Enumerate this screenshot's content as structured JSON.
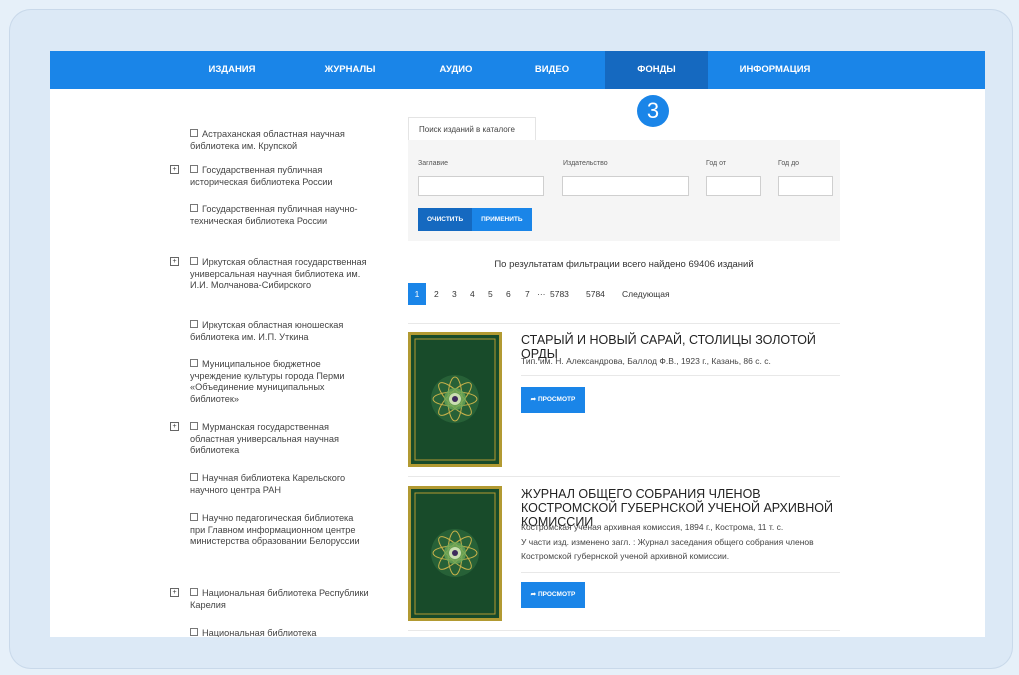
{
  "nav": {
    "items": [
      {
        "label": "ИЗДАНИЯ"
      },
      {
        "label": "ЖУРНАЛЫ"
      },
      {
        "label": "АУДИО"
      },
      {
        "label": "ВИДЕО"
      },
      {
        "label": "ФОНДЫ"
      },
      {
        "label": "ИНФОРМАЦИЯ"
      }
    ],
    "active_index": 4
  },
  "step_badge": "3",
  "sidebar": {
    "libraries": [
      {
        "label": "Астраханская областная научная библиотека им. Крупской",
        "expandable": false
      },
      {
        "label": "Государственная публичная историческая библиотека России",
        "expandable": true
      },
      {
        "label": "Государственная публичная научно-техническая библиотека России",
        "expandable": false
      },
      {
        "label": "Иркутская областная государственная универсальная научная библиотека им. И.И. Молчанова-Сибирского",
        "expandable": true
      },
      {
        "label": "Иркутская областная юношеская библиотека им. И.П. Уткина",
        "expandable": false
      },
      {
        "label": "Муниципальное бюджетное учреждение культуры города Перми «Объединение муниципальных библиотек»",
        "expandable": false
      },
      {
        "label": "Мурманская государственная областная универсальная научная библиотека",
        "expandable": true
      },
      {
        "label": "Научная библиотека Карельского научного центра РАН",
        "expandable": false
      },
      {
        "label": "Научно педагогическая библиотека при Главном информационном центре министерства образовании Белоруссии",
        "expandable": false
      },
      {
        "label": "Национальная библиотека Республики Карелия",
        "expandable": true
      },
      {
        "label": "Национальная библиотека",
        "expandable": false
      }
    ],
    "expand_symbol": "+"
  },
  "search": {
    "tab_label": "Поиск изданий в каталоге",
    "fields": {
      "title_label": "Заглавие",
      "publisher_label": "Издательство",
      "year_from_label": "Год от",
      "year_to_label": "Год до"
    },
    "clear_label": "ОЧИСТИТЬ",
    "apply_label": "ПРИМЕНИТЬ"
  },
  "results": {
    "summary": "По результатам фильтрации всего найдено 69406 изданий"
  },
  "pagination": {
    "pages": [
      "1",
      "2",
      "3",
      "4",
      "5",
      "6",
      "7",
      "···",
      "5783",
      "5784",
      "Следующая"
    ],
    "current": "1"
  },
  "items": [
    {
      "title": "СТАРЫЙ И НОВЫЙ САРАЙ, СТОЛИЦЫ ЗОЛОТОЙ ОРДЫ",
      "meta": "Тип. им. Н. Александрова, Баллод Ф.В., 1923 г., Казань, 86 с. с.",
      "note": "",
      "view_label": "ПРОСМОТР"
    },
    {
      "title": "ЖУРНАЛ ОБЩЕГО СОБРАНИЯ ЧЛЕНОВ КОСТРОМСКОЙ ГУБЕРНСКОЙ УЧЕНОЙ АРХИВНОЙ КОМИССИИ",
      "meta": "Костромская ученая архивная комиссия, 1894 г., Кострома, 11 т. с.",
      "note": "У части изд. изменено загл. : Журнал заседания общего собрания членов Костромской губернской ученой архивной комиссии.",
      "view_label": "ПРОСМОТР"
    }
  ],
  "colors": {
    "nav_bg": "#1a85e8",
    "nav_active": "#1569c0",
    "cover_green": "#184b2a",
    "cover_gold": "#b29a32"
  },
  "icons": {
    "view": "share-arrow-icon",
    "expand": "plus-box-icon",
    "checkbox": "checkbox-icon"
  }
}
